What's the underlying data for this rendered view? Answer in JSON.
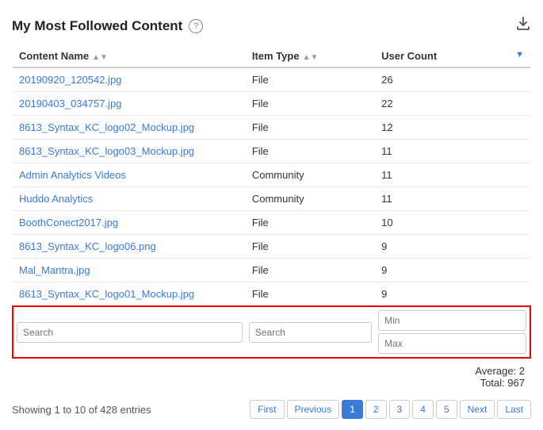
{
  "title": "My Most Followed Content",
  "help_icon": "?",
  "columns": [
    {
      "label": "Content Name",
      "key": "content_name",
      "sortable": true
    },
    {
      "label": "Item Type",
      "key": "item_type",
      "sortable": true
    },
    {
      "label": "User Count",
      "key": "user_count",
      "sortable": false,
      "has_filter_icon": true
    }
  ],
  "rows": [
    {
      "content_name": "20190920_120542.jpg",
      "item_type": "File",
      "user_count": 26
    },
    {
      "content_name": "20190403_034757.jpg",
      "item_type": "File",
      "user_count": 22
    },
    {
      "content_name": "8613_Syntax_KC_logo02_Mockup.jpg",
      "item_type": "File",
      "user_count": 12
    },
    {
      "content_name": "8613_Syntax_KC_logo03_Mockup.jpg",
      "item_type": "File",
      "user_count": 11
    },
    {
      "content_name": "Admin Analytics Videos",
      "item_type": "Community",
      "user_count": 11
    },
    {
      "content_name": "Huddo Analytics",
      "item_type": "Community",
      "user_count": 11
    },
    {
      "content_name": "BoothConect2017.jpg",
      "item_type": "File",
      "user_count": 10
    },
    {
      "content_name": "8613_Syntax_KC_logo06.png",
      "item_type": "File",
      "user_count": 9
    },
    {
      "content_name": "Mal_Mantra.jpg",
      "item_type": "File",
      "user_count": 9
    },
    {
      "content_name": "8613_Syntax_KC_logo01_Mockup.jpg",
      "item_type": "File",
      "user_count": 9
    }
  ],
  "filters": {
    "content_name_placeholder": "Search",
    "item_type_placeholder": "Search",
    "min_placeholder": "Min",
    "max_placeholder": "Max"
  },
  "summary": {
    "average_label": "Average: 2",
    "total_label": "Total: 967"
  },
  "pagination": {
    "entries_info": "Showing 1 to 10 of 428 entries",
    "first_label": "First",
    "previous_label": "Previous",
    "next_label": "Next",
    "last_label": "Last",
    "pages": [
      "1",
      "2",
      "3",
      "4",
      "5"
    ],
    "active_page": "1"
  }
}
